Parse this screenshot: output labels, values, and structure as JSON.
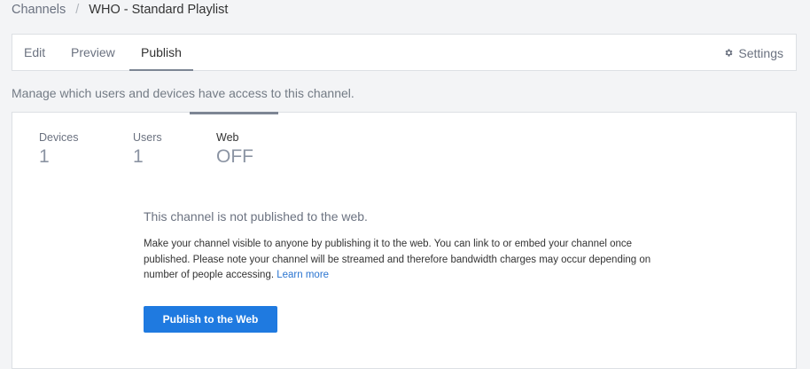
{
  "breadcrumb": {
    "parent": "Channels",
    "separator": "/",
    "current": "WHO - Standard Playlist"
  },
  "tabs": {
    "edit": "Edit",
    "preview": "Preview",
    "publish": "Publish",
    "active": "Publish"
  },
  "settings": {
    "label": "Settings",
    "icon": "gear-icon"
  },
  "description": "Manage which users and devices have access to this channel.",
  "stats": {
    "devices": {
      "label": "Devices",
      "value": "1"
    },
    "users": {
      "label": "Users",
      "value": "1"
    },
    "web": {
      "label": "Web",
      "value": "OFF"
    }
  },
  "web_panel": {
    "heading": "This channel is not published to the web.",
    "body": "Make your channel visible to anyone by publishing it to the web. You can link to or embed your channel once published. Please note your channel will be streamed and therefore bandwidth charges may occur depending on number of people accessing.",
    "learn_more": "Learn more",
    "button": "Publish to the Web"
  },
  "colors": {
    "primary_button": "#1f7ae0",
    "link": "#2a74d0",
    "active_indicator": "#7d8694"
  }
}
